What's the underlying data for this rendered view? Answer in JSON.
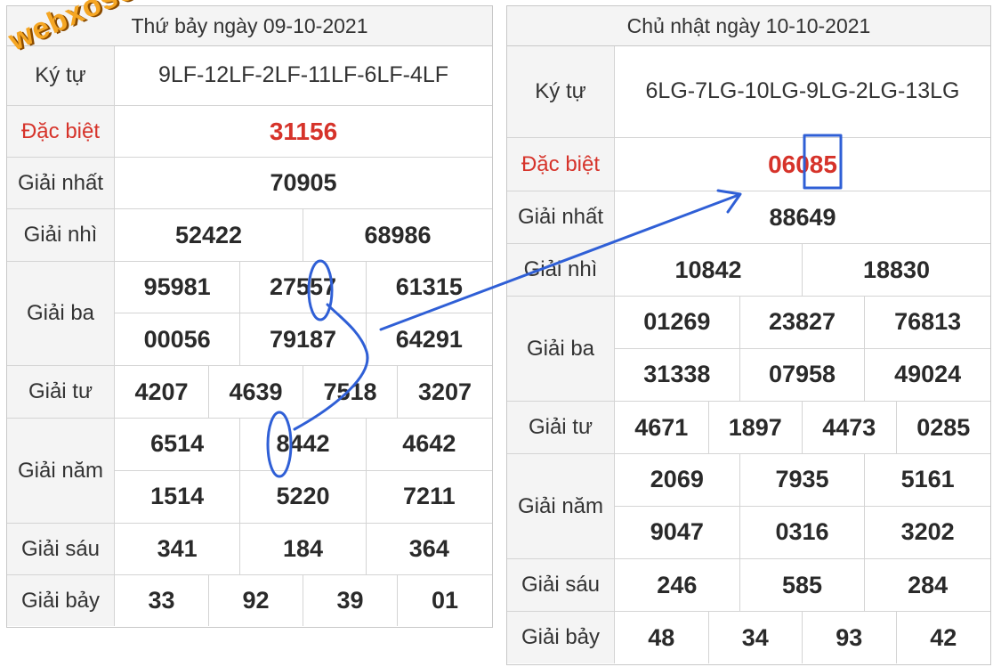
{
  "watermark": "webxoso.net",
  "left": {
    "date_title": "Thứ bảy ngày 09-10-2021",
    "labels": {
      "ky_tu": "Ký tự",
      "dac_biet": "Đặc biệt",
      "giai_nhat": "Giải nhất",
      "giai_nhi": "Giải nhì",
      "giai_ba": "Giải ba",
      "giai_tu": "Giải tư",
      "giai_nam": "Giải năm",
      "giai_sau": "Giải sáu",
      "giai_bay": "Giải bảy"
    },
    "ky_tu": "9LF-12LF-2LF-11LF-6LF-4LF",
    "dac_biet": "31156",
    "giai_nhat": "70905",
    "giai_nhi": [
      "52422",
      "68986"
    ],
    "giai_ba": [
      "95981",
      "27557",
      "61315",
      "00056",
      "79187",
      "64291"
    ],
    "giai_tu": [
      "4207",
      "4639",
      "7518",
      "3207"
    ],
    "giai_nam": [
      "6514",
      "8442",
      "4642",
      "1514",
      "5220",
      "7211"
    ],
    "giai_sau": [
      "341",
      "184",
      "364"
    ],
    "giai_bay": [
      "33",
      "92",
      "39",
      "01"
    ]
  },
  "right": {
    "date_title": "Chủ nhật ngày 10-10-2021",
    "labels": {
      "ky_tu": "Ký tự",
      "dac_biet": "Đặc biệt",
      "giai_nhat": "Giải nhất",
      "giai_nhi": "Giải nhì",
      "giai_ba": "Giải ba",
      "giai_tu": "Giải tư",
      "giai_nam": "Giải năm",
      "giai_sau": "Giải sáu",
      "giai_bay": "Giải bảy"
    },
    "ky_tu": "6LG-7LG-10LG-9LG-2LG-13LG",
    "dac_biet": "06085",
    "giai_nhat": "88649",
    "giai_nhi": [
      "10842",
      "18830"
    ],
    "giai_ba": [
      "01269",
      "23827",
      "76813",
      "31338",
      "07958",
      "49024"
    ],
    "giai_tu": [
      "4671",
      "1897",
      "4473",
      "0285"
    ],
    "giai_nam": [
      "2069",
      "7935",
      "5161",
      "9047",
      "0316",
      "3202"
    ],
    "giai_sau": [
      "246",
      "585",
      "284"
    ],
    "giai_bay": [
      "48",
      "34",
      "93",
      "42"
    ]
  },
  "annotation_color": "#2f5fd6",
  "brand_colors": {
    "red": "#d6332a",
    "watermark": "#f5a623"
  }
}
